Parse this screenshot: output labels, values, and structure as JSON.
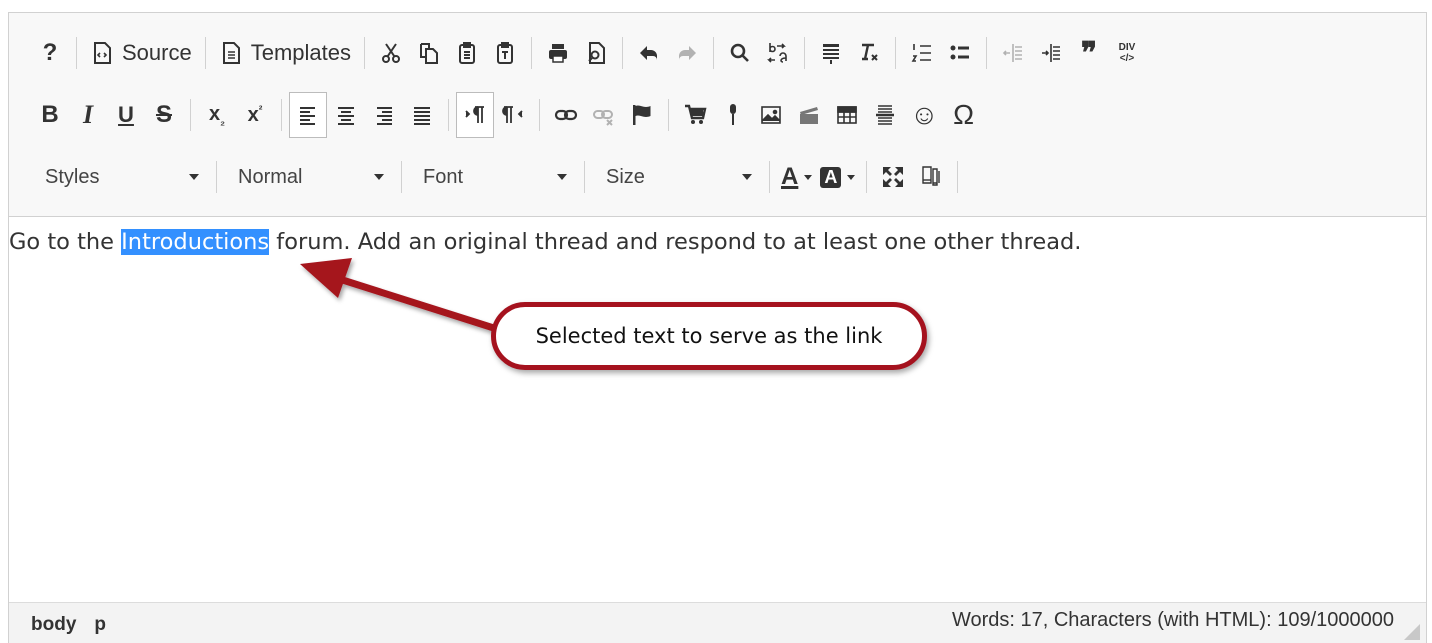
{
  "toolbar": {
    "source_label": "Source",
    "templates_label": "Templates",
    "help_glyph": "?",
    "bold_glyph": "B",
    "italic_glyph": "I",
    "underline_glyph": "U",
    "strike_glyph": "S",
    "subscript_glyph": "x",
    "subscript_mark": "₂",
    "superscript_glyph": "x",
    "superscript_mark": "²",
    "blockquote_glyph": "❞",
    "special_char_glyph": "Ω",
    "smiley_glyph": "☺",
    "div_glyph_top": "DIV",
    "div_glyph_bottom": "</>",
    "styles_label": "Styles",
    "format_label": "Normal",
    "font_label": "Font",
    "size_label": "Size",
    "text_color_glyph": "A",
    "bg_color_glyph": "A"
  },
  "content": {
    "before": "Go to the ",
    "selected": "Introductions",
    "after": " forum. Add an original thread and respond to at least one other thread."
  },
  "statusbar": {
    "path": [
      "body",
      "p"
    ],
    "wordcount": "Words: 17, Characters (with HTML): 109/1000000"
  },
  "annotation": {
    "callout_text": "Selected text to serve as the link",
    "accent": "#a5121e"
  },
  "colors": {
    "selection": "#3390ff",
    "toolbar_bg": "#f8f8f8"
  }
}
